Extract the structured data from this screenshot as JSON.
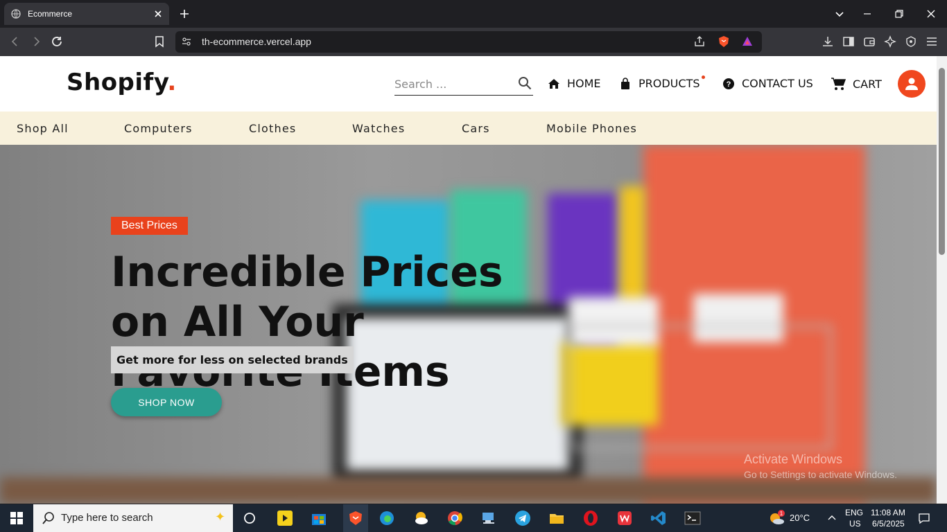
{
  "browser": {
    "tab_title": "Ecommerce",
    "url": "th-ecommerce.vercel.app"
  },
  "site": {
    "logo_text": "Shopify",
    "logo_dot": ".",
    "search_placeholder": "Search ...",
    "nav": {
      "home": "HOME",
      "products": "PRODUCTS",
      "contact": "CONTACT US",
      "cart": "CART"
    },
    "categories": [
      "Shop All",
      "Computers",
      "Clothes",
      "Watches",
      "Cars",
      "Mobile Phones"
    ]
  },
  "hero": {
    "badge": "Best Prices",
    "headline": "Incredible Prices on All Your Favorite Items",
    "subline": "Get more for less on selected brands",
    "cta": "SHOP NOW"
  },
  "watermark": {
    "line1": "Activate Windows",
    "line2": "Go to Settings to activate Windows."
  },
  "taskbar": {
    "search_placeholder": "Type here to search",
    "weather": "20°C",
    "weather_badge": "1",
    "lang1": "ENG",
    "lang2": "US",
    "time": "11:08 AM",
    "date": "6/5/2025"
  },
  "colors": {
    "accent": "#e9421c",
    "cta": "#2a9d8f",
    "category_bar": "#f8f1dc"
  }
}
